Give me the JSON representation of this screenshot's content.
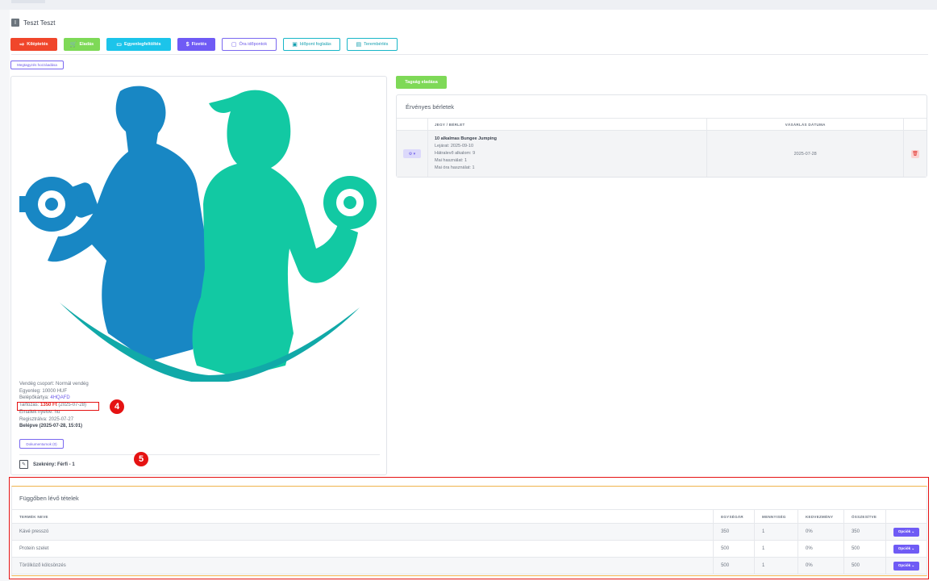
{
  "user": {
    "initial": "I",
    "name": "Teszt Teszt"
  },
  "actions": [
    {
      "label": "Kiléptetés",
      "icon": "⇨"
    },
    {
      "label": "Eladás",
      "icon": "🛒"
    },
    {
      "label": "Egyenlegfeltöltés",
      "icon": "▭"
    },
    {
      "label": "Fizetés",
      "icon": "$"
    },
    {
      "label": "Óra időpontok",
      "icon": "▢"
    },
    {
      "label": "Időpont foglalás",
      "icon": "▣"
    },
    {
      "label": "Terembérlés",
      "icon": "▤"
    }
  ],
  "open_profile_label": "Megtagyzés hozzáadása",
  "member_info": {
    "group": "Vendég csoport: Normál vendég",
    "balance": "Egyenleg: 10000 HUF",
    "card_label": "Belépőkártya: ",
    "card_value": "4HQAFD",
    "debt_label": "Tartozás: ",
    "debt_value": "1350 Ft",
    "debt_date": " (2025-07-28)",
    "email_lang": "Emailek nyelve: hu",
    "registered": "Regisztrálva: 2025-07-27",
    "checked_in": "Belépve (2025-07-28, 15:01)"
  },
  "documents_button": "Dokumentumok (0)",
  "locker": "Szekrény: Férfi - 1",
  "annotations": {
    "a4": "4",
    "a5": "5"
  },
  "sell_membership_button": "Tagság eladása",
  "valid_passes": {
    "title": "Érvényes bérletek",
    "headers": [
      "JEGY / BÉRLET",
      "VÁSÁRLÁS DÁTUMA"
    ],
    "rows": [
      {
        "name": "10 alkalmas Bungee Jumping",
        "expiry": "Lejárat: 2025-09-10",
        "remaining": "Hátralevő alkalom: 9",
        "today_use": "Mai használat: 1",
        "today_class_use": "Mai óra használat: 1",
        "date": "2025-07-28",
        "options_icon": "⚙ ▾",
        "delete_icon": "🗑"
      }
    ]
  },
  "pending_items": {
    "title": "Függőben lévő tételek",
    "headers": [
      "TERMÉK NEVE",
      "EGYSÉGÁR",
      "MENNYISÉG",
      "KEDVEZMÉNY",
      "ÖSSZESÍTVE",
      ""
    ],
    "rows": [
      {
        "name": "Kávé presszó",
        "unit": "350",
        "qty": "1",
        "discount": "0%",
        "total": "350",
        "btn": "Opciók ⌄"
      },
      {
        "name": "Protein szelet",
        "unit": "500",
        "qty": "1",
        "discount": "0%",
        "total": "500",
        "btn": "Opciók ⌄"
      },
      {
        "name": "Törölköző kölcsönzés",
        "unit": "500",
        "qty": "1",
        "discount": "0%",
        "total": "500",
        "btn": "Opciók ⌄"
      }
    ]
  },
  "colors": {
    "accent": "#6f5bf5",
    "danger": "#f0462b",
    "success": "#7ed957",
    "info": "#1cc4ea",
    "male": "#1887c4",
    "female": "#12c9a3"
  }
}
